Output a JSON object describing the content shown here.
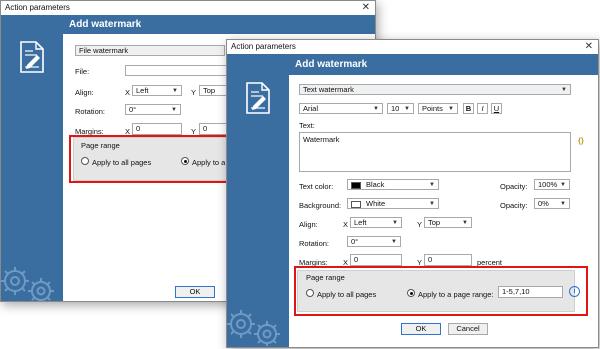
{
  "back": {
    "title": "Action parameters",
    "header": "Add watermark",
    "type_select": "File watermark",
    "file_label": "File:",
    "file_value": "",
    "align_label": "Align:",
    "align_x_axis": "X",
    "align_x": "Left",
    "align_y_axis": "Y",
    "align_y": "Top",
    "rotation_label": "Rotation:",
    "rotation": "0°",
    "margins_label": "Margins:",
    "margin_x_axis": "X",
    "margin_x": "0",
    "margin_y_axis": "Y",
    "margin_y": "0",
    "page_range_title": "Page range",
    "apply_all": "Apply to all pages",
    "apply_range": "Apply to a",
    "ok": "OK"
  },
  "front": {
    "title": "Action parameters",
    "header": "Add watermark",
    "type_select": "Text watermark",
    "font": "Arial",
    "font_size": "10",
    "unit": "Points",
    "bold": "B",
    "italic": "I",
    "underline": "U",
    "text_label": "Text:",
    "text_value": "Watermark",
    "macro": "{}",
    "text_color_label": "Text color:",
    "text_color": "Black",
    "opacity_label": "Opacity:",
    "opacity": "100%",
    "background_label": "Background:",
    "background": "White",
    "opacity2_label": "Opacity:",
    "opacity2": "0%",
    "align_label": "Align:",
    "align_x_axis": "X",
    "align_x": "Left",
    "align_y_axis": "Y",
    "align_y": "Top",
    "rotation_label": "Rotation:",
    "rotation": "0°",
    "margins_label": "Margins:",
    "margin_x_axis": "X",
    "margin_x": "0",
    "margin_y_axis": "Y",
    "margin_y": "0",
    "margin_unit": "percent",
    "page_range_title": "Page range",
    "apply_all": "Apply to all pages",
    "apply_range": "Apply to a page range:",
    "range_value": "1-5,7,10",
    "info": "i",
    "ok": "OK",
    "cancel": "Cancel"
  },
  "colors": {
    "sidebar": "#3a6ea0",
    "highlight": "#e01515",
    "text_color_swatch": "#000000",
    "background_swatch": "#ffffff"
  },
  "icons": [
    "document-edit-icon",
    "gear-icon",
    "close-icon",
    "info-icon"
  ]
}
